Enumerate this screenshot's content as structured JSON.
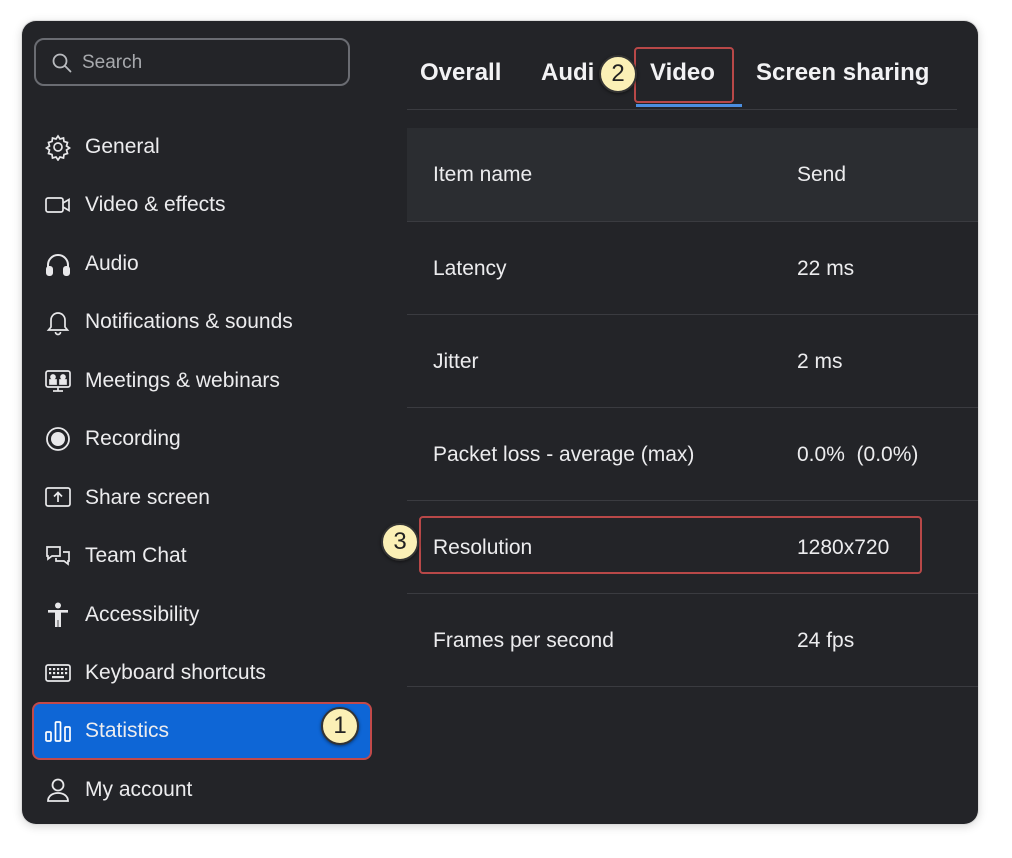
{
  "search": {
    "placeholder": "Search"
  },
  "sidebar": {
    "items": [
      {
        "label": "General",
        "icon": "gear-icon"
      },
      {
        "label": "Video & effects",
        "icon": "video-camera-icon"
      },
      {
        "label": "Audio",
        "icon": "headphones-icon"
      },
      {
        "label": "Notifications & sounds",
        "icon": "bell-icon"
      },
      {
        "label": "Meetings & webinars",
        "icon": "monitor-people-icon"
      },
      {
        "label": "Recording",
        "icon": "record-icon"
      },
      {
        "label": "Share screen",
        "icon": "share-screen-icon"
      },
      {
        "label": "Team Chat",
        "icon": "chat-bubbles-icon"
      },
      {
        "label": "Accessibility",
        "icon": "accessibility-icon"
      },
      {
        "label": "Keyboard shortcuts",
        "icon": "keyboard-icon"
      },
      {
        "label": "Statistics",
        "icon": "bar-chart-icon",
        "active": true
      },
      {
        "label": "My account",
        "icon": "user-icon"
      }
    ]
  },
  "tabs": [
    {
      "label": "Overall"
    },
    {
      "label": "Audi"
    },
    {
      "label": "Video",
      "active": true
    },
    {
      "label": "Screen sharing"
    }
  ],
  "table": {
    "headers": [
      "Item name",
      "Send"
    ],
    "rows": [
      [
        "Latency",
        "22 ms"
      ],
      [
        "Jitter",
        "2 ms"
      ],
      [
        "Packet loss - average (max)",
        "0.0%  (0.0%)"
      ],
      [
        "Resolution",
        "1280x720"
      ],
      [
        "Frames per second",
        "24 fps"
      ]
    ]
  },
  "callouts": [
    "1",
    "2",
    "3"
  ],
  "colors": {
    "accent": "#0e66d6",
    "background": "#232428",
    "highlight_box": "#b84848",
    "badge": "#fbf0b6"
  }
}
